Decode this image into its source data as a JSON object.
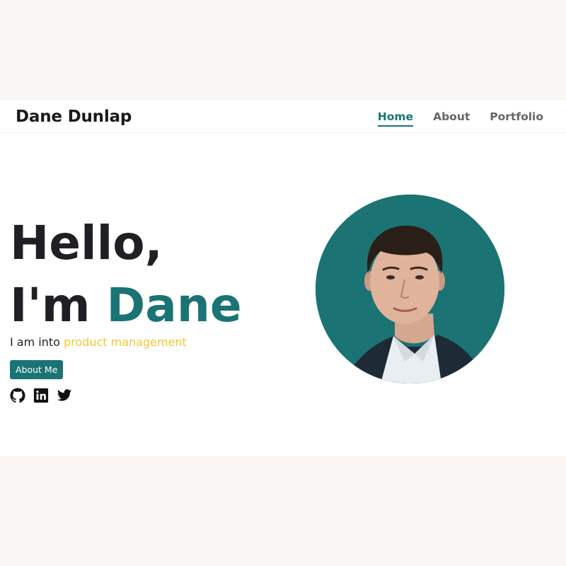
{
  "header": {
    "brand": "Dane Dunlap",
    "nav": [
      {
        "label": "Home",
        "active": true
      },
      {
        "label": "About",
        "active": false
      },
      {
        "label": "Portfolio",
        "active": false
      }
    ]
  },
  "hero": {
    "greeting_line1": "Hello,",
    "greeting_prefix": "I'm ",
    "greeting_name": "Dane",
    "into_prefix": "I am into ",
    "into_highlight": "product management",
    "about_button": "About Me"
  },
  "socials": [
    {
      "icon": "github-icon"
    },
    {
      "icon": "linkedin-icon"
    },
    {
      "icon": "twitter-icon"
    }
  ],
  "colors": {
    "accent": "#1a7374",
    "highlight": "#f5c633",
    "text": "#1f2024",
    "page_bg": "#f9f6f3"
  }
}
